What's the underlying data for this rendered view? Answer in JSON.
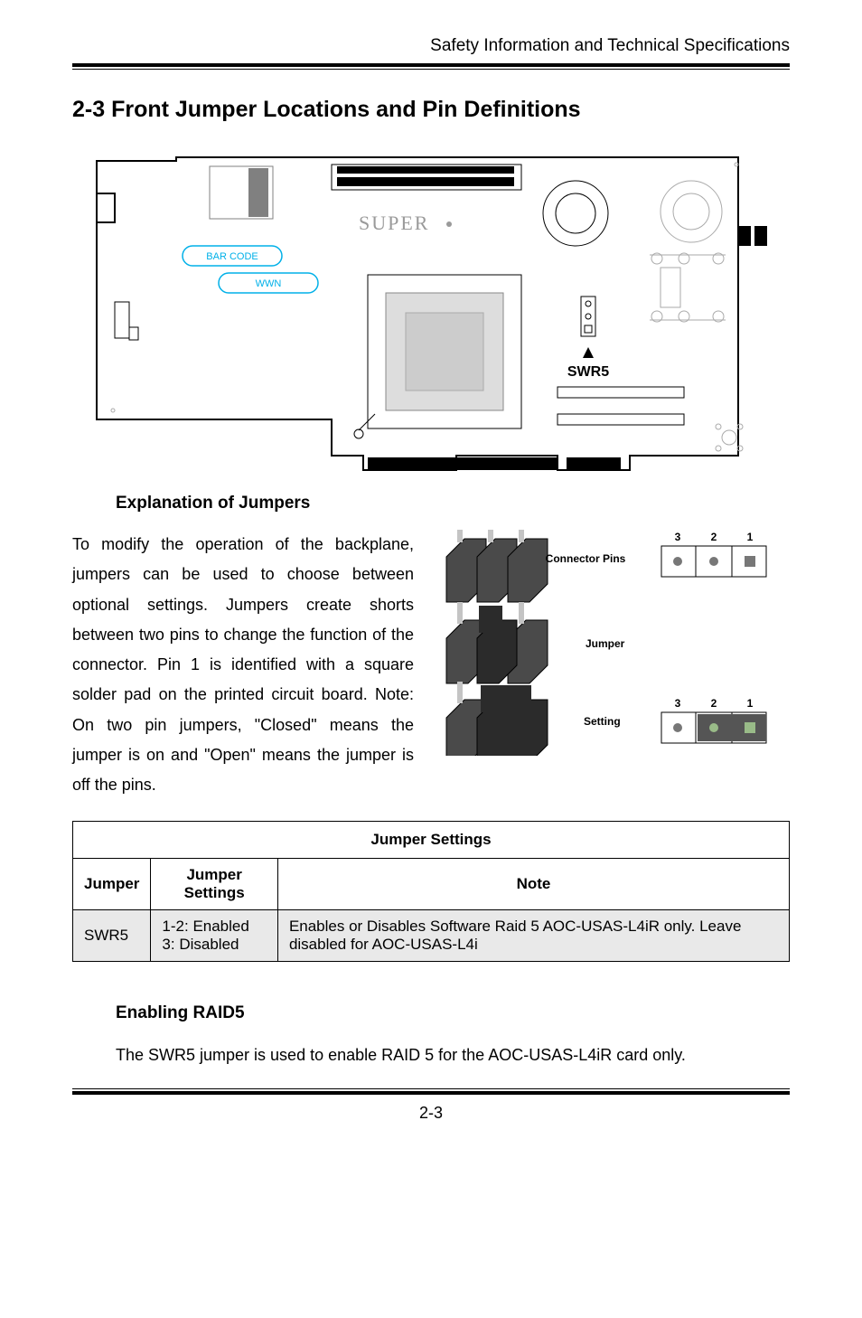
{
  "header": {
    "running_title": "Safety Information and Technical Specifications"
  },
  "section": {
    "title": "2-3 Front Jumper Locations and Pin Definitions"
  },
  "diagram": {
    "barcode_label": "BAR CODE",
    "wwn_label": "WWN",
    "swr5_label": "SWR5",
    "brand": "SUPER"
  },
  "jumpers_expl": {
    "heading": "Explanation of Jumpers",
    "text": "To modify the operation of the backplane, jumpers can be used to choose between optional settings.  Jumpers create shorts between two pins to change the function of the connector.  Pin 1 is identified with a square solder pad on the printed circuit board.  Note: On two pin jumpers, \"Closed\" means the jumper is on and \"Open\" means the jumper is off the pins.",
    "labels": {
      "connector_pins": "Connector Pins",
      "jumper": "Jumper",
      "setting": "Setting",
      "p3": "3",
      "p2": "2",
      "p1": "1"
    }
  },
  "table": {
    "title": "Jumper Settings",
    "headers": {
      "jumper": "Jumper",
      "settings": "Jumper Settings",
      "note": "Note"
    },
    "row": {
      "jumper": "SWR5",
      "settings": "1-2: Enabled\n3: Disabled",
      "note": "Enables or Disables Software Raid 5 AOC-USAS-L4iR only.  Leave disabled for AOC-USAS-L4i"
    }
  },
  "raid5": {
    "heading": "Enabling RAID5",
    "text": "The SWR5 jumper is used to enable RAID 5 for the AOC-USAS-L4iR card only."
  },
  "footer": {
    "page": "2-3"
  }
}
